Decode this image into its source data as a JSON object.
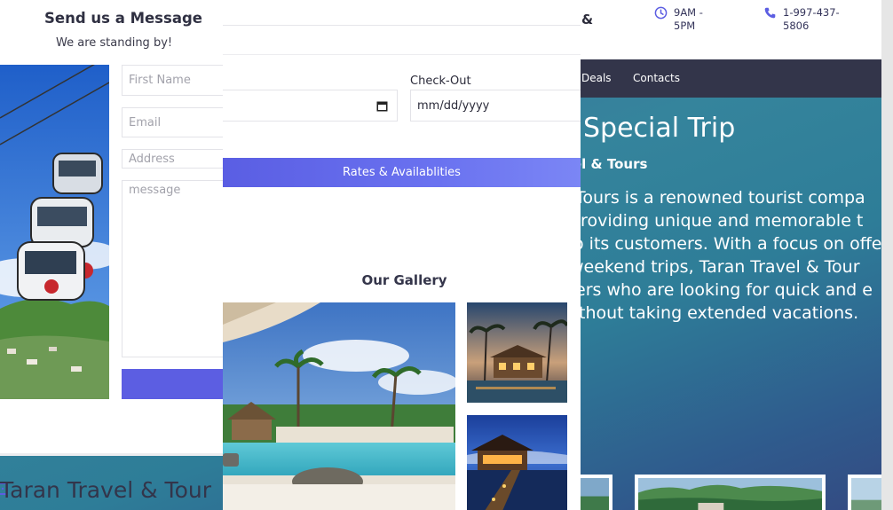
{
  "header": {
    "brand_fragment": "&",
    "hours": "9AM - 5PM",
    "phone": "1-997-437-5806",
    "accent_color": "#5c5ee2"
  },
  "nav": {
    "items": [
      "Deals",
      "Contacts"
    ]
  },
  "hero": {
    "title": "Special Trip",
    "subtitle": "el & Tours",
    "paragraph_lines": [
      "Tours is a renowned tourist compa",
      "providing unique and memorable t",
      "o its customers. With a focus on offe",
      "weekend trips, Taran Travel & Tour",
      "ers who are looking for quick and e",
      "thout taking extended vacations."
    ]
  },
  "contact": {
    "title": "Send us a Message",
    "subtitle": "We are standing by!",
    "fields": {
      "first_name_placeholder": "First Name",
      "email_placeholder": "Email",
      "address_placeholder": "Address",
      "message_placeholder": "message"
    },
    "button_color": "#5c5ee2"
  },
  "booking": {
    "checkout_label": "Check-Out",
    "checkout_value": "mm/dd/yyyy",
    "rates_button": "Rates & Availablities"
  },
  "gallery": {
    "title": "Our Gallery"
  },
  "footer": {
    "brand": "Taran Travel & Tour"
  },
  "icons": [
    "clock-icon",
    "phone-icon",
    "calendar-icon",
    "chat-icon"
  ]
}
